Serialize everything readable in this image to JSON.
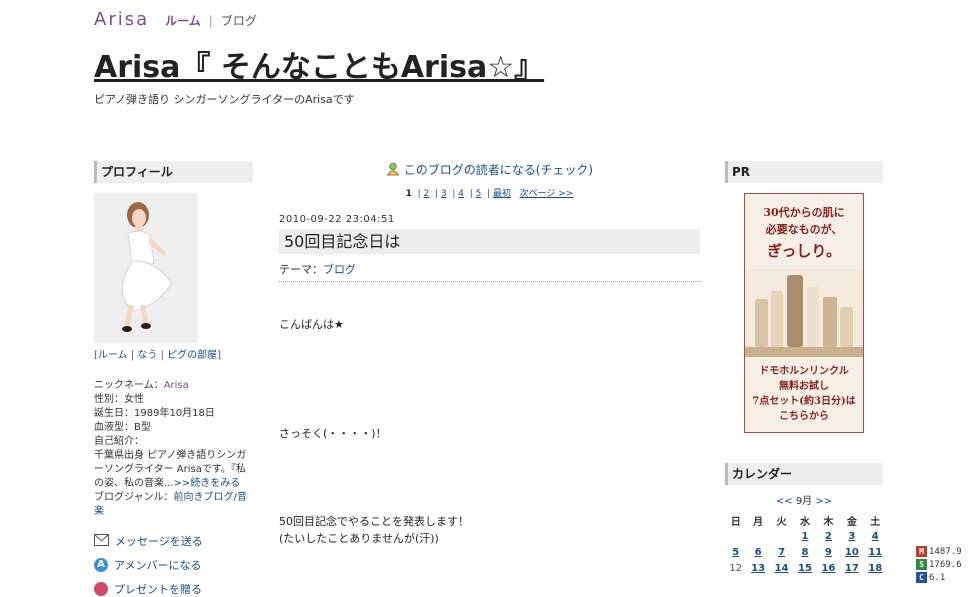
{
  "header": {
    "brand": "Arisa",
    "nav_room": "ルーム",
    "nav_sep": "|",
    "nav_blog": "ブログ",
    "title": "Arisa『 そんなこともArisa☆』",
    "description": "ピアノ弾き語り シンガーソングライターのArisaです"
  },
  "sidebar_left": {
    "profile_heading": "プロフィール",
    "links": {
      "open": "[",
      "room": "ルーム",
      "sep1": "|",
      "nau": "なう",
      "sep2": "|",
      "pigg": "ピグの部屋",
      "close": "]"
    },
    "info": {
      "nickname_label": "ニックネーム：",
      "nickname": "Arisa",
      "gender": "性別：女性",
      "birthday": "誕生日：1989年10月18日",
      "blood": "血液型：B型",
      "intro_label": "自己紹介：",
      "intro_text": "千葉県出身 ピアノ弾き語りシンガーソングライター Arisaです。『私の姿、私の音楽...",
      "read_more": ">>続きをみる",
      "genre_label": "ブログジャンル：",
      "genre": "前向きブログ/音楽"
    },
    "actions": [
      {
        "label": "メッセージを送る",
        "icon": "envelope-icon"
      },
      {
        "label": "アメンバーになる",
        "icon": "amember-icon"
      },
      {
        "label": "プレゼントを贈る",
        "icon": "gift-icon"
      }
    ]
  },
  "main": {
    "reader_link": "このブログの読者になる(チェック)",
    "pager": {
      "current": "1",
      "pages": [
        "2",
        "3",
        "4",
        "5"
      ],
      "first": "最初",
      "next": "次ページ >>"
    },
    "entry": {
      "date": "2010-09-22 23:04:51",
      "title": "50回目記念日は",
      "theme_label": "テーマ：",
      "theme": "ブログ",
      "lines": [
        "こんばんは★",
        "さっそく(・・・・)！",
        "50回目記念でやることを発表します！",
        "(たいしたことありませんが(汗))"
      ]
    }
  },
  "sidebar_right": {
    "pr_heading": "PR",
    "ad": {
      "headline": [
        "30代からの肌に",
        "必要なものが、",
        "ぎっしり。"
      ],
      "footer": [
        "ドモホルンリンクル",
        "無料お試し",
        "7点セット(約3日分)は",
        "こちらから"
      ]
    },
    "calendar_heading": "カレンダー",
    "calendar": {
      "prev": "<<",
      "month": "9月",
      "next": ">>",
      "weekdays": [
        "日",
        "月",
        "火",
        "水",
        "木",
        "金",
        "土"
      ],
      "weeks": [
        [
          "",
          "",
          "",
          "1",
          "2",
          "3",
          "4"
        ],
        [
          "5",
          "6",
          "7",
          "8",
          "9",
          "10",
          "11"
        ],
        [
          "12",
          "13",
          "14",
          "15",
          "16",
          "17",
          "18"
        ]
      ],
      "linked_days": [
        "1",
        "2",
        "3",
        "4",
        "5",
        "6",
        "7",
        "8",
        "9",
        "10",
        "11",
        "13",
        "14",
        "15",
        "16",
        "17",
        "18"
      ]
    }
  },
  "stock_widget": [
    {
      "badge": "M",
      "value": "1487.9",
      "color": "#c0392b"
    },
    {
      "badge": "S",
      "value": "1769.6",
      "color": "#2e8b3a"
    },
    {
      "badge": "C",
      "value": "6.1",
      "color": "#1f4fa8"
    }
  ],
  "colors": {
    "accent_purple": "#7a4f8f",
    "link_blue": "#1a4d8c",
    "heading_bg": "#eeeeee"
  }
}
